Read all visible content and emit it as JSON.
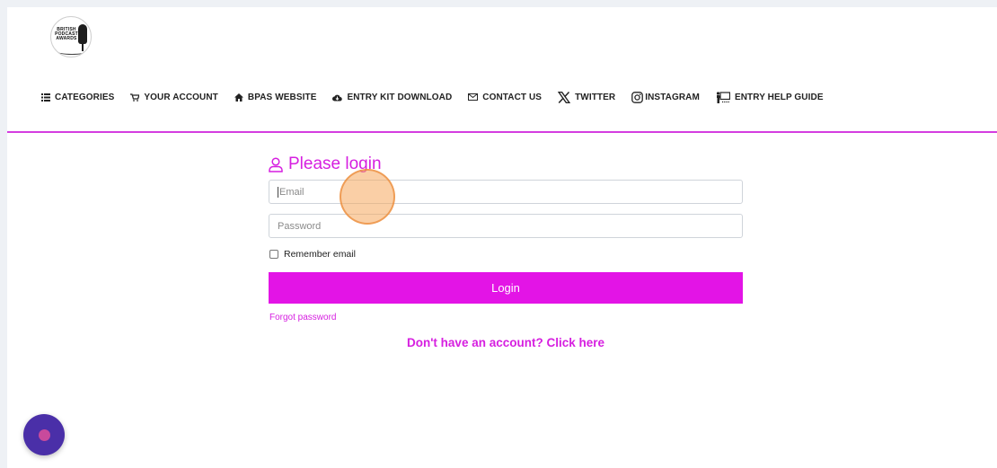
{
  "logo": {
    "text": "BRITISH PODCAST AWARDS"
  },
  "nav": {
    "items": [
      {
        "label": "CATEGORIES",
        "icon": "list-icon"
      },
      {
        "label": "YOUR ACCOUNT",
        "icon": "cart-icon"
      },
      {
        "label": "BPAS WEBSITE",
        "icon": "home-icon"
      },
      {
        "label": "ENTRY KIT DOWNLOAD",
        "icon": "cloud-download-icon"
      },
      {
        "label": "CONTACT US",
        "icon": "envelope-icon"
      },
      {
        "label": "TWITTER",
        "icon": "x-logo-icon"
      },
      {
        "label": "INSTAGRAM",
        "icon": "instagram-icon"
      },
      {
        "label": "ENTRY HELP GUIDE",
        "icon": "presenter-icon"
      }
    ]
  },
  "login": {
    "title": "Please login",
    "email_placeholder": "Email",
    "password_placeholder": "Password",
    "remember_label": "Remember email",
    "button_label": "Login",
    "forgot_label": "Forgot password",
    "signup_label": "Don't have an account? Click here"
  },
  "colors": {
    "accent": "#e314e6",
    "accent_text": "#d61fe0",
    "divider": "#d43de0",
    "fab": "#4a2fa8"
  }
}
